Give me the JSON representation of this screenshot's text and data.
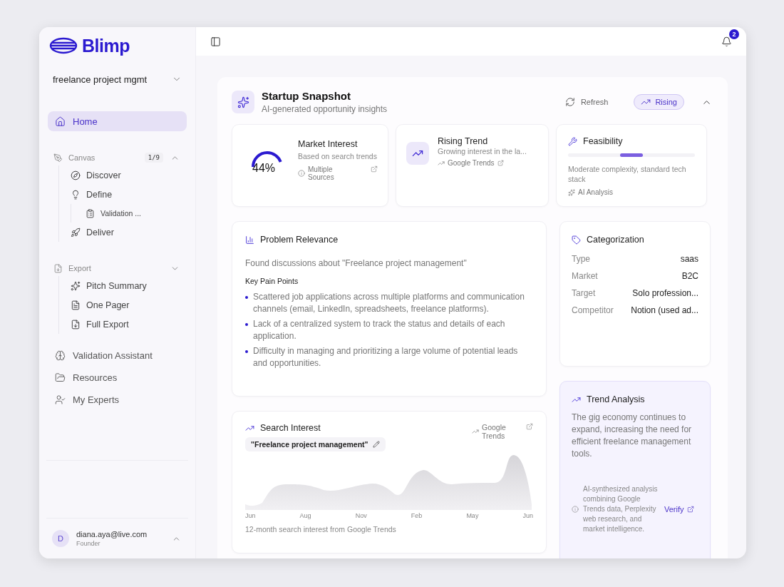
{
  "brand": {
    "name": "Blimp"
  },
  "project": {
    "name": "freelance project mgmt"
  },
  "nav": [
    {
      "label": "Home",
      "selected": true
    }
  ],
  "sections": [
    {
      "label": "Canvas",
      "count": "1/9",
      "expanded": true,
      "items": [
        {
          "label": "Discover"
        },
        {
          "label": "Define",
          "children": [
            {
              "label": "Validation ..."
            }
          ]
        },
        {
          "label": "Deliver"
        }
      ]
    },
    {
      "label": "Export",
      "expanded": false,
      "items": [
        {
          "label": "Pitch Summary"
        },
        {
          "label": "One Pager"
        },
        {
          "label": "Full Export"
        }
      ]
    }
  ],
  "bottom_nav": [
    {
      "label": "Validation Assistant",
      "selected": false
    },
    {
      "label": "Resources",
      "selected": false
    },
    {
      "label": "My Experts",
      "selected": false
    }
  ],
  "user": {
    "initial": "D",
    "email": "diana.aya@live.com",
    "role": "Founder"
  },
  "topbar": {
    "notifications": "2"
  },
  "snapshot": {
    "title": "Startup Snapshot",
    "subtitle": "AI-generated opportunity insights",
    "refresh": "Refresh",
    "badge": "Rising"
  },
  "market_interest": {
    "value": "44%",
    "level": 0.44,
    "title": "Market Interest",
    "subtitle": "Based on search trends",
    "source": "Multiple Sources"
  },
  "rising_trend": {
    "title": "Rising Trend",
    "subtitle": "Growing interest in the la...",
    "source": "Google Trends"
  },
  "feasibility": {
    "title": "Feasibility",
    "segments": [
      {
        "selected": false
      },
      {
        "selected": true
      },
      {
        "selected": false
      }
    ],
    "description": "Moderate complexity, standard tech stack",
    "source": "AI Analysis"
  },
  "problem": {
    "title": "Problem Relevance",
    "summary": "Found discussions about \"Freelance project management\"",
    "heading": "Key Pain Points",
    "points": [
      "Scattered job applications across multiple platforms and communication channels (email, LinkedIn, spreadsheets, freelance platforms).",
      "Lack of a centralized system to track the status and details of each application.",
      "Difficulty in managing and prioritizing a large volume of potential leads and opportunities."
    ]
  },
  "categorization": {
    "title": "Categorization",
    "rows": [
      {
        "label": "Type",
        "value": "saas"
      },
      {
        "label": "Market",
        "value": "B2C"
      },
      {
        "label": "Target",
        "value": "Solo profession..."
      },
      {
        "label": "Competitor",
        "value": "Notion (used ad..."
      }
    ]
  },
  "trend_analysis": {
    "title": "Trend Analysis",
    "text": "The gig economy continues to expand, increasing the need for efficient freelance management tools.",
    "note": "AI-synthesized analysis combining Google Trends data, Perplexity web research, and market intelligence.",
    "link": "Verify"
  },
  "search_interest": {
    "title": "Search Interest",
    "query": "\"Freelance project management\"",
    "source": "Google Trends",
    "axis_labels": [
      "Jun",
      "Aug",
      "Nov",
      "Feb",
      "May",
      "Jun"
    ],
    "caption": "12-month search interest from Google Trends"
  }
}
